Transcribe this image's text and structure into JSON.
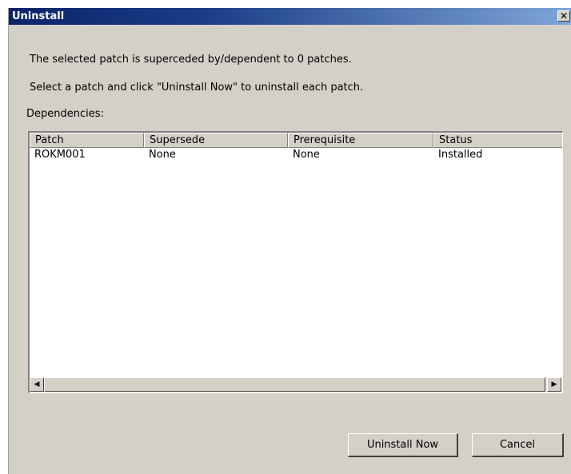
{
  "window": {
    "title": "Uninstall",
    "close_glyph": "✕"
  },
  "messages": {
    "line1": "The selected patch is superceded by/dependent to 0 patches.",
    "line2": "Select a patch and click \"Uninstall Now\" to uninstall each patch.",
    "dependencies_label": "Dependencies:"
  },
  "table": {
    "columns": [
      "Patch",
      "Supersede",
      "Prerequisite",
      "Status"
    ],
    "rows": [
      [
        "ROKM001",
        "None",
        "None",
        "Installed"
      ]
    ]
  },
  "scrollbar": {
    "left_icon": "scroll-left-arrow-icon",
    "right_icon": "scroll-right-arrow-icon",
    "left_glyph": "◀",
    "right_glyph": "▶"
  },
  "buttons": {
    "uninstall_now": "Uninstall Now",
    "cancel": "Cancel"
  },
  "colors": {
    "titlebar_start": "#0a246a",
    "titlebar_end": "#7fa6d8",
    "dialog_bg": "#d4d0c8"
  }
}
